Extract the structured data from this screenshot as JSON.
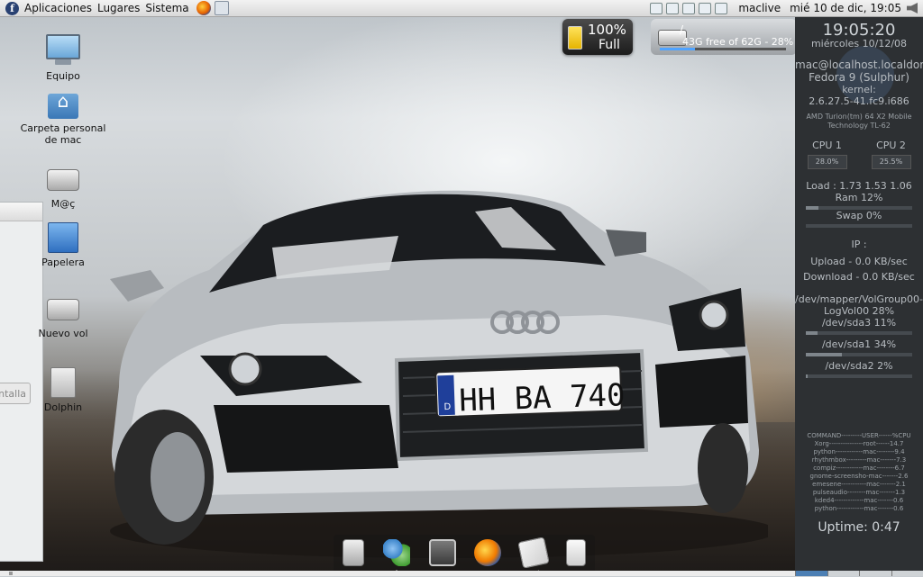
{
  "top_panel": {
    "menus": [
      "Aplicaciones",
      "Lugares",
      "Sistema"
    ],
    "user": "maclive",
    "clock": "mié 10 de dic, 19:05"
  },
  "desktop_icons": [
    {
      "label": "Equipo",
      "icon": "computer-icon"
    },
    {
      "label": "Carpeta personal de mac",
      "icon": "home-folder-icon"
    },
    {
      "label": "M@ç",
      "icon": "drive-icon"
    },
    {
      "label": "Papelera",
      "icon": "trash-icon"
    },
    {
      "label": "Nuevo vol",
      "icon": "drive-icon"
    },
    {
      "label": "Dolphin",
      "icon": "file-cabinet-icon"
    }
  ],
  "left_window": {
    "button_fragment": "ntalla"
  },
  "wallpaper": {
    "license_plate": "HH BA 740",
    "country_code": "D"
  },
  "battery_widget": {
    "percent": "100%",
    "state": "Full"
  },
  "drive_widget": {
    "mount": "/",
    "free_text": "43G free of 62G - 28%",
    "used_fraction": 0.28
  },
  "conky": {
    "time": "19:05:20",
    "date": "miércoles 10/12/08",
    "host": "mac@localhost.localdomain",
    "os": "Fedora 9 (Sulphur)",
    "kernel_label": "kernel:",
    "kernel": "2.6.27.5-41.fc9.i686",
    "cpu_model_1": "AMD Turion(tm) 64 X2 Mobile",
    "cpu_model_2": "Technology TL-62",
    "cpu1_label": "CPU 1",
    "cpu1_value": "28.0%",
    "cpu2_label": "CPU 2",
    "cpu2_value": "25.5%",
    "load": "Load : 1.73 1.53 1.06",
    "ram": "Ram 12%",
    "ram_fraction": 0.12,
    "swap": "Swap 0%",
    "ip": "IP :",
    "upload": "Upload - 0.0 KB/sec",
    "download": "Download - 0.0 KB/sec",
    "fs1_a": "/dev/mapper/VolGroup00-",
    "fs1_b": "LogVol00 28%",
    "fs1_fraction": 0.28,
    "fs2": "/dev/sda3 11%",
    "fs2_fraction": 0.11,
    "fs3": "/dev/sda1 34%",
    "fs3_fraction": 0.34,
    "fs4": "/dev/sda2 2%",
    "fs4_fraction": 0.02,
    "process_header": "COMMAND---------USER------%CPU",
    "processes": [
      "Xorg---------------root------14.7",
      "python------------mac--------9.4",
      "rhythmbox---------mac-------7.3",
      "compiz------------mac--------6.7",
      "gnome-screensho-mac-------2.6",
      "emesene-----------mac-------2.1",
      "pulseaudio--------mac-------1.3",
      "kded4-------------mac-------0.6",
      "python------------mac-------0.6"
    ],
    "uptime": "Uptime: 0:47"
  },
  "dock": {
    "items": [
      "file-cabinet-icon",
      "users-icon",
      "terminal-icon",
      "firefox-icon",
      "mail-icon",
      "media-player-icon"
    ]
  },
  "colors": {
    "panel": "#dcdcdc",
    "conky_bg": "#2d3033",
    "accent": "#4c7fb4"
  }
}
